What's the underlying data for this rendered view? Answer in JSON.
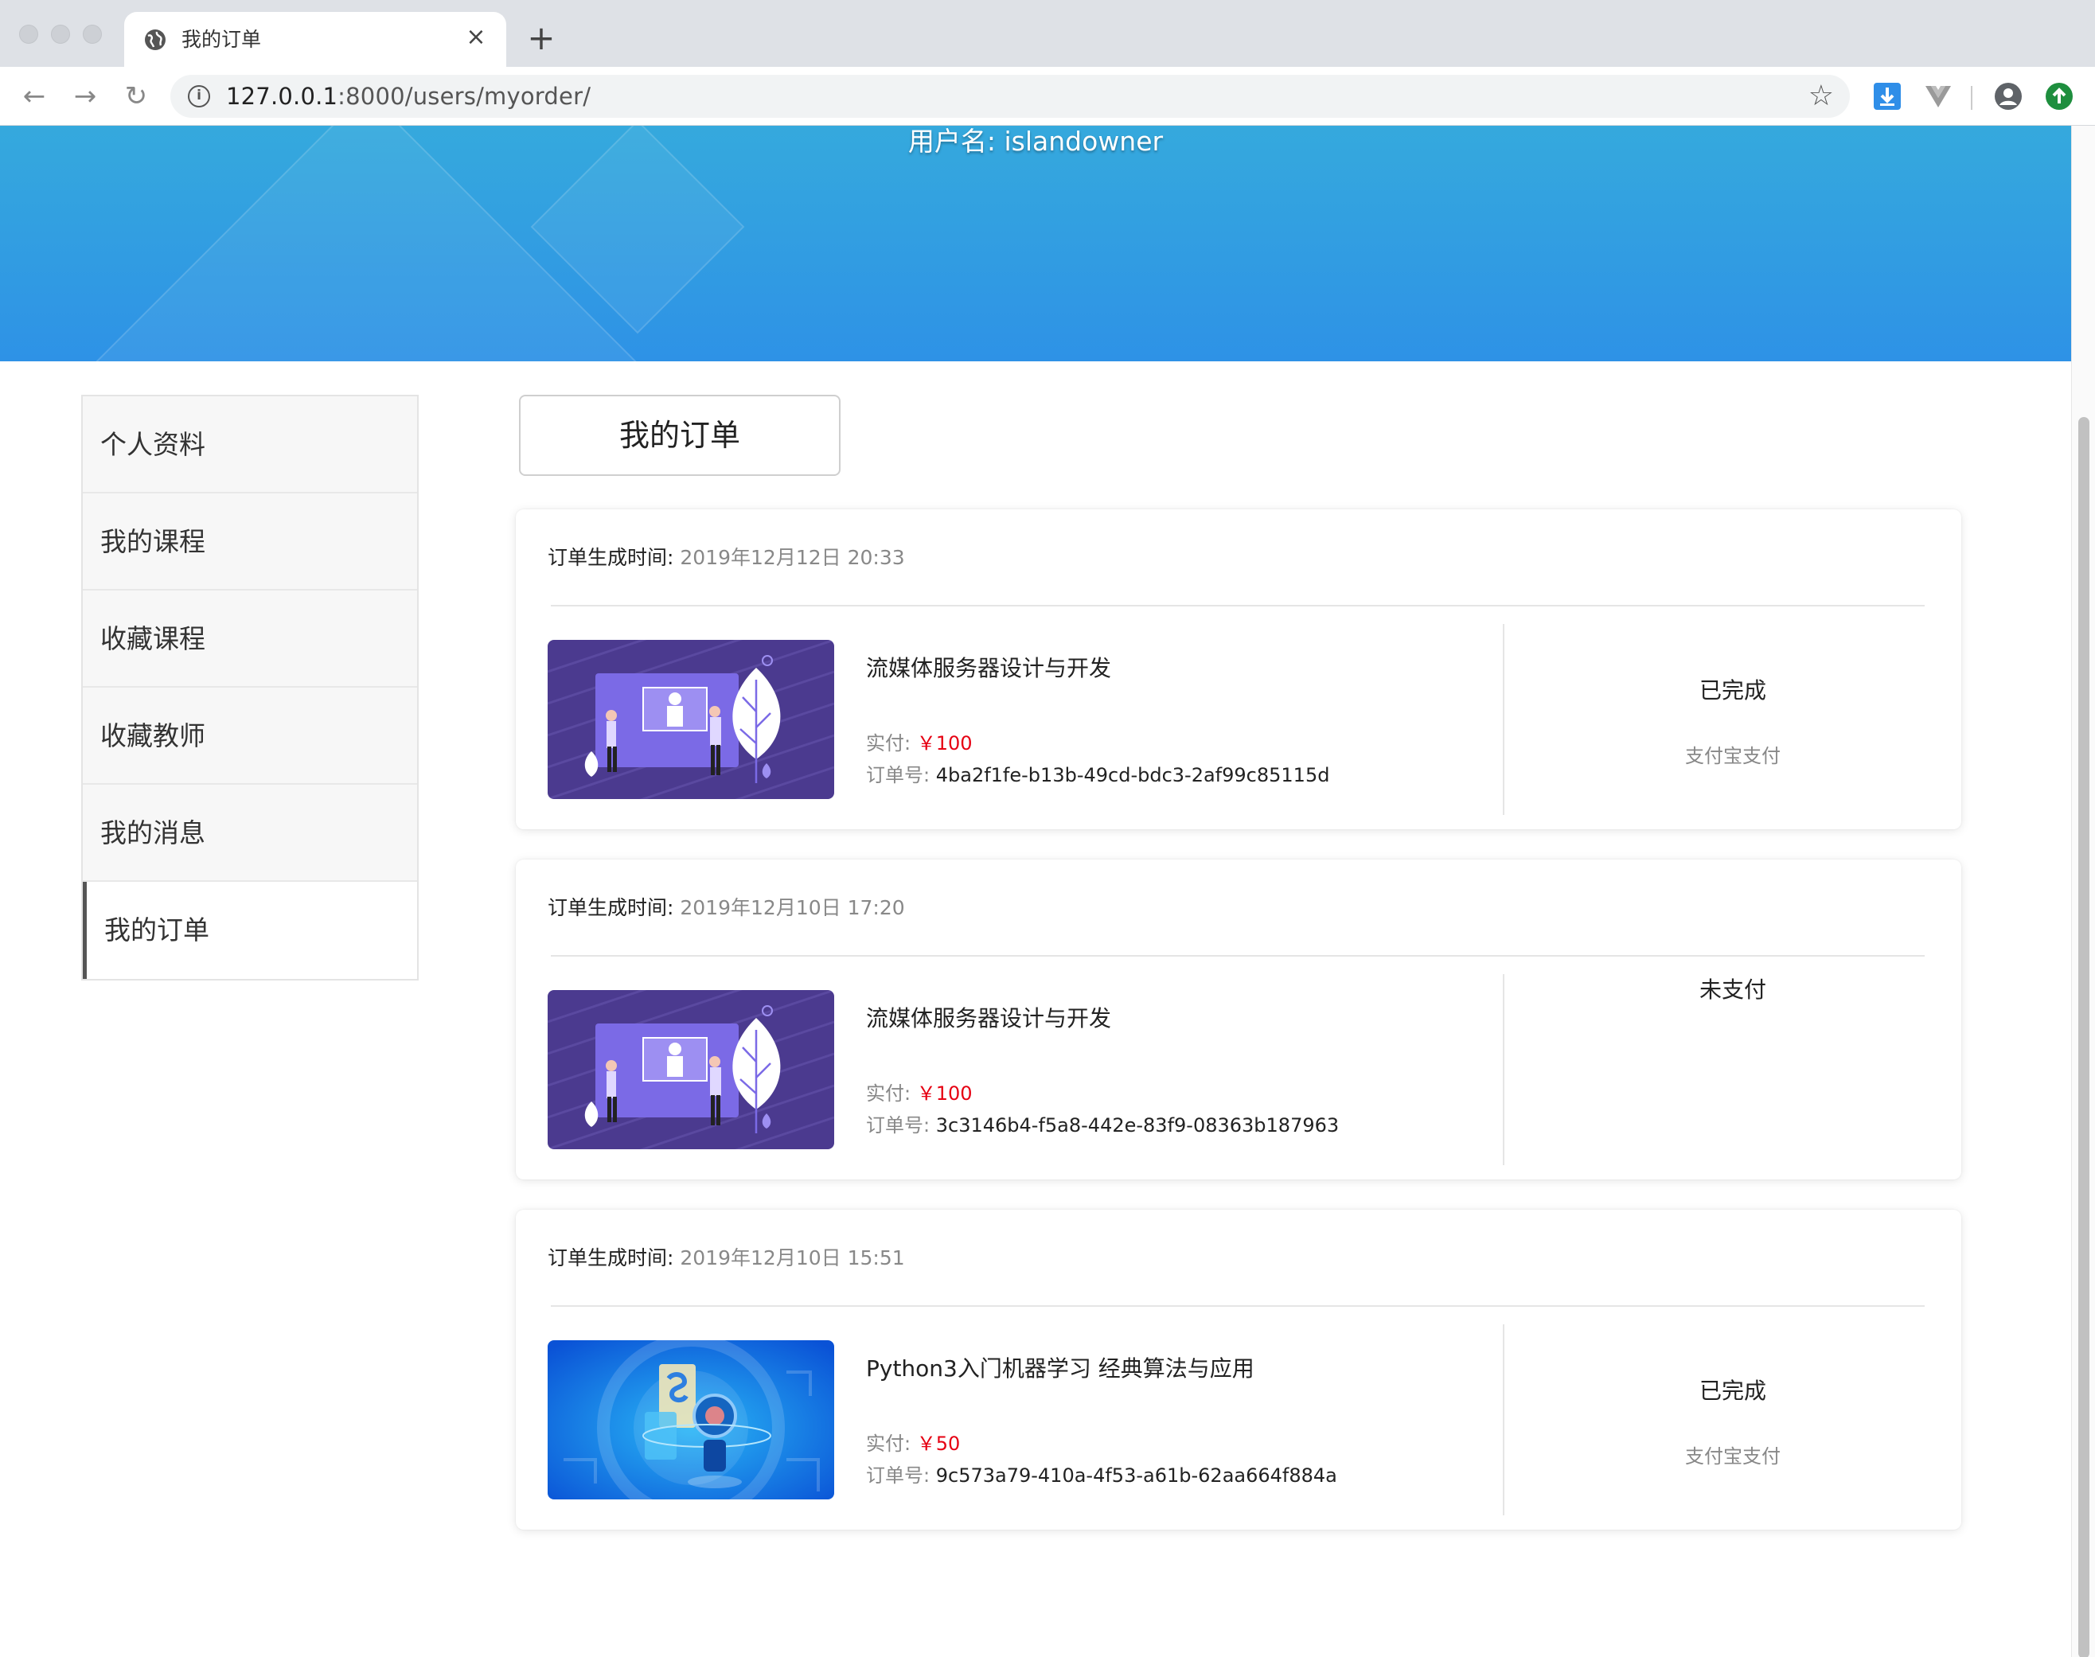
{
  "browser": {
    "tab_title": "我的订单",
    "tab_close": "×",
    "new_tab": "+",
    "url_host": "127.0.0.1",
    "url_rest": ":8000/users/myorder/",
    "back": "←",
    "forward": "→",
    "reload": "↻",
    "bookmark": "☆"
  },
  "header": {
    "username_label": "用户名: islandowner"
  },
  "sidebar": {
    "items": [
      {
        "label": "个人资料",
        "active": false
      },
      {
        "label": "我的课程",
        "active": false
      },
      {
        "label": "收藏课程",
        "active": false
      },
      {
        "label": "收藏教师",
        "active": false
      },
      {
        "label": "我的消息",
        "active": false
      },
      {
        "label": "我的订单",
        "active": true
      }
    ]
  },
  "main": {
    "heading": "我的订单",
    "labels": {
      "order_time": "订单生成时间:",
      "paid": "实付:",
      "order_no": "订单号:"
    },
    "orders": [
      {
        "time": "2019年12月12日 20:33",
        "course": "流媒体服务器设计与开发",
        "price": "￥100",
        "order_no": "4ba2f1fe-b13b-49cd-bdc3-2af99c85115d",
        "status": "已完成",
        "pay_method": "支付宝支付",
        "thumb": "streaming-illustration"
      },
      {
        "time": "2019年12月10日 17:20",
        "course": "流媒体服务器设计与开发",
        "price": "￥100",
        "order_no": "3c3146b4-f5a8-442e-83f9-08363b187963",
        "status": "未支付",
        "pay_method": "",
        "thumb": "streaming-illustration"
      },
      {
        "time": "2019年12月10日 15:51",
        "course": "Python3入门机器学习 经典算法与应用",
        "price": "￥50",
        "order_no": "9c573a79-410a-4f53-a61b-62aa664f884a",
        "status": "已完成",
        "pay_method": "支付宝支付",
        "thumb": "python-ml-illustration"
      }
    ]
  },
  "colors": {
    "banner_top": "#35a9dd",
    "banner_bottom": "#2e92e6",
    "price": "#e60012",
    "thumb_purple": "#4b3a8f",
    "thumb_blue": "#0d6de0"
  }
}
